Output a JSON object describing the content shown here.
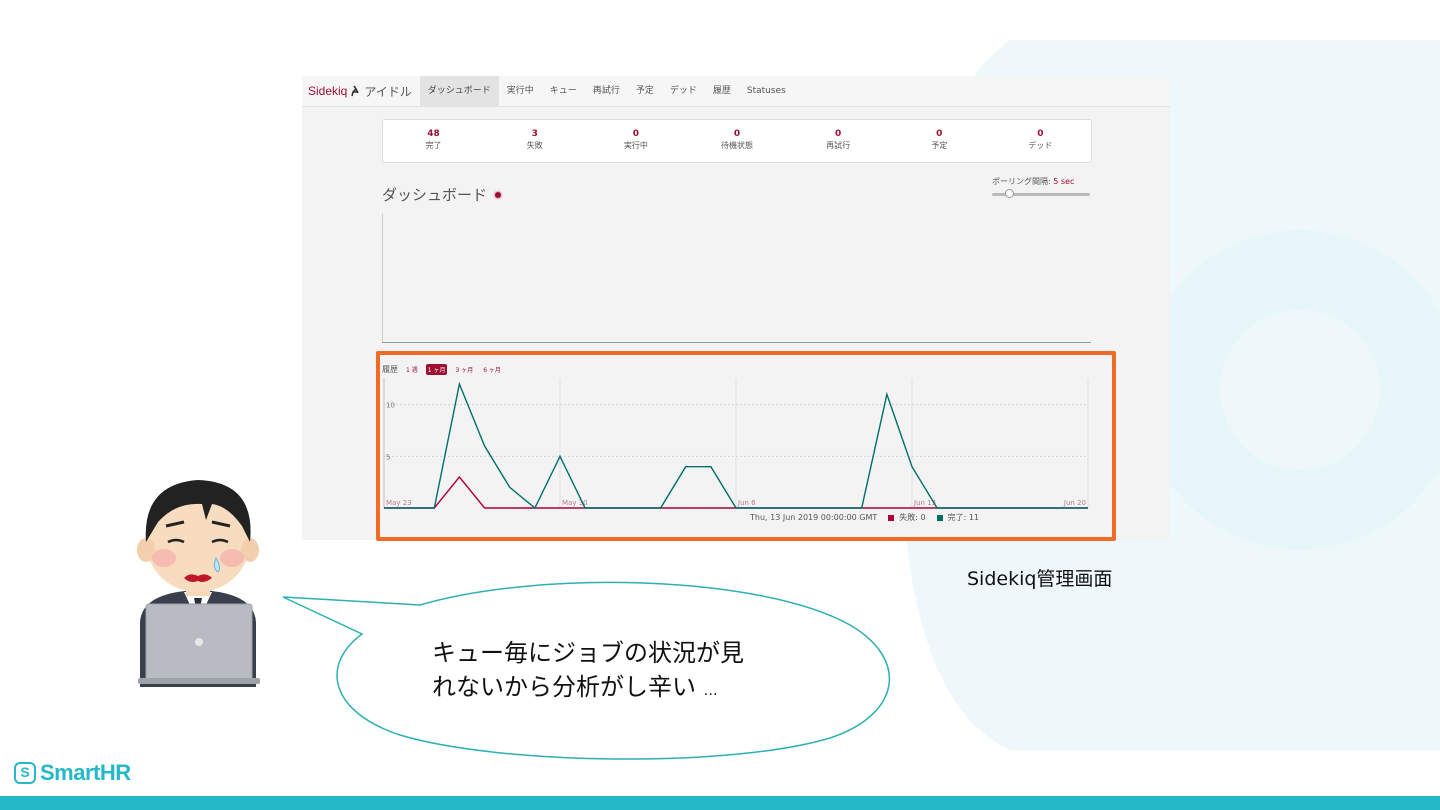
{
  "brand": {
    "name": "SmartHR",
    "mark": "S"
  },
  "sidekiq": {
    "brand_name": "Sidekiq",
    "status": "アイドル",
    "nav": [
      "ダッシュボード",
      "実行中",
      "キュー",
      "再試行",
      "予定",
      "デッド",
      "履歴",
      "Statuses"
    ],
    "active_nav": "ダッシュボード",
    "summary": [
      {
        "value": "48",
        "label": "完了"
      },
      {
        "value": "3",
        "label": "失敗"
      },
      {
        "value": "0",
        "label": "実行中"
      },
      {
        "value": "0",
        "label": "待機状態"
      },
      {
        "value": "0",
        "label": "再試行"
      },
      {
        "value": "0",
        "label": "予定"
      },
      {
        "value": "0",
        "label": "デッド"
      }
    ],
    "dashboard_title": "ダッシュボード",
    "polling_label": "ポーリング間隔:",
    "polling_value": "5 sec",
    "polling_level": 0.14,
    "history_label": "履歴",
    "history_ranges": [
      "1 週",
      "1 ヶ月",
      "3 ヶ月",
      "6 ヶ月"
    ],
    "history_selected": "1 ヶ月",
    "legend_date": "Thu, 13 Jun 2019 00:00:00 GMT",
    "legend_failed": "失敗: 0",
    "legend_processed": "完了: 11",
    "colors": {
      "failed": "#b1003e",
      "processed": "#006f68",
      "accent": "#9e0f30"
    }
  },
  "chart_data": {
    "type": "line",
    "x_labels": [
      "May 23",
      "May 30",
      "Jun 6",
      "Jun 13",
      "Jun 20"
    ],
    "ylim": [
      0,
      12
    ],
    "y_ticks": [
      5,
      10
    ],
    "grid": true,
    "series": [
      {
        "name": "完了",
        "color": "#006f68",
        "values": [
          0,
          0,
          0,
          12,
          6,
          2,
          0,
          5,
          0,
          0,
          0,
          0,
          4,
          4,
          0,
          0,
          0,
          0,
          0,
          0,
          11,
          4,
          0,
          0,
          0,
          0,
          0,
          0,
          0
        ]
      },
      {
        "name": "失敗",
        "color": "#b1003e",
        "values": [
          0,
          0,
          0,
          3,
          0,
          0,
          0,
          0,
          0,
          0,
          0,
          0,
          0,
          0,
          0,
          0,
          0,
          0,
          0,
          0,
          0,
          0,
          0,
          0,
          0,
          0,
          0,
          0,
          0
        ]
      }
    ]
  },
  "caption": "Sidekiq管理画面",
  "speech": {
    "line1": "キュー毎にジョブの状況が見",
    "line2": "れないから分析がし辛い",
    "ellipsis": "…"
  }
}
